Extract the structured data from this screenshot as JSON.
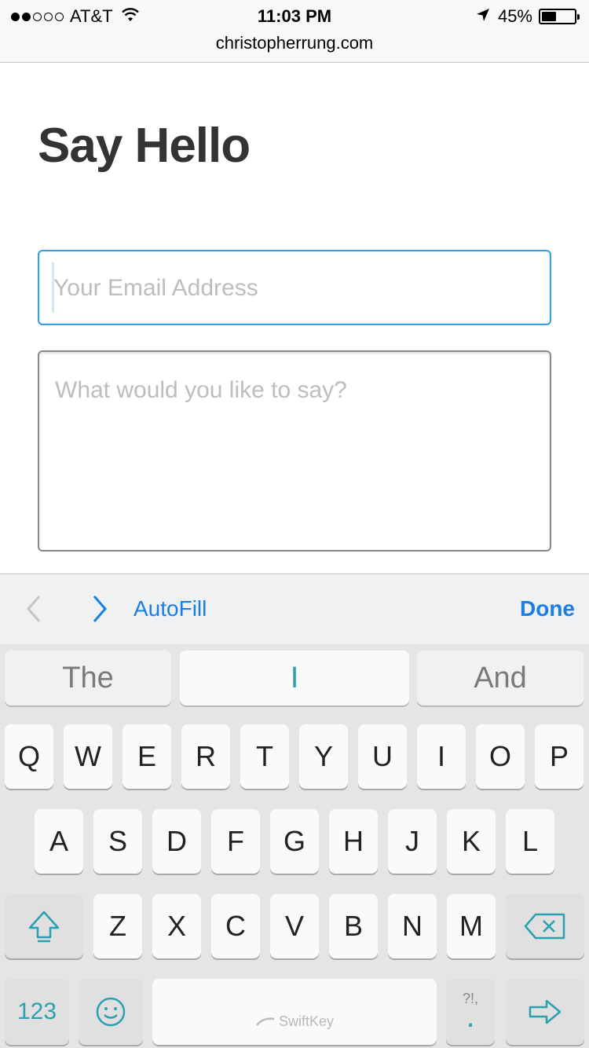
{
  "status_bar": {
    "carrier": "AT&T",
    "time": "11:03 PM",
    "battery_percent_text": "45%",
    "battery_level": 0.45,
    "signal_bars_filled": 2,
    "signal_bars_total": 5
  },
  "browser": {
    "url": "christopherrung.com"
  },
  "page": {
    "title": "Say Hello",
    "email_placeholder": "Your Email Address",
    "message_placeholder": "What would you like to say?"
  },
  "accessory_bar": {
    "autofill_label": "AutoFill",
    "done_label": "Done"
  },
  "keyboard": {
    "predictions": [
      "The",
      "I",
      "And"
    ],
    "row1": [
      "Q",
      "W",
      "E",
      "R",
      "T",
      "Y",
      "U",
      "I",
      "O",
      "P"
    ],
    "row2": [
      "A",
      "S",
      "D",
      "F",
      "G",
      "H",
      "J",
      "K",
      "L"
    ],
    "row3": [
      "Z",
      "X",
      "C",
      "V",
      "B",
      "N",
      "M"
    ],
    "numbers_label": "123",
    "space_brand": "SwiftKey",
    "punct_small": "?!,",
    "punct_main": "."
  },
  "colors": {
    "accent_blue": "#1a7ee6",
    "focus_border": "#3a9fd9",
    "keyboard_teal": "#2aa0b0"
  }
}
